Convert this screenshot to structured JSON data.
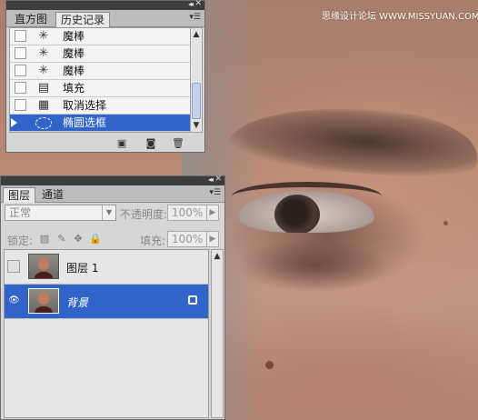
{
  "watermark": "思缘设计论坛 WWW.MISSYUAN.COM",
  "history_panel": {
    "tabs": [
      "直方图",
      "历史记录"
    ],
    "active_tab": 1,
    "items": [
      {
        "icon": "magic-wand-icon",
        "label": "魔棒"
      },
      {
        "icon": "magic-wand-icon",
        "label": "魔棒"
      },
      {
        "icon": "magic-wand-icon",
        "label": "魔棒"
      },
      {
        "icon": "fill-icon",
        "label": "填充"
      },
      {
        "icon": "deselect-icon",
        "label": "取消选择"
      },
      {
        "icon": "elliptical-marquee-icon",
        "label": "椭圆选框"
      }
    ],
    "selected_index": 5
  },
  "layers_panel": {
    "tabs": [
      "图层",
      "通道"
    ],
    "active_tab": 0,
    "blend_mode": "正常",
    "opacity_label": "不透明度:",
    "opacity_value": "100%",
    "lock_label": "锁定:",
    "fill_label": "填充:",
    "fill_value": "100%",
    "layers": [
      {
        "name": "图层 1",
        "visible": false,
        "selected": false,
        "locked": false
      },
      {
        "name": "背景",
        "visible": true,
        "selected": true,
        "locked": true
      }
    ]
  },
  "colors": {
    "selection_blue": "#3164c8",
    "panel_gray": "#d6d6d6",
    "titlebar": "#3d3d3d"
  }
}
